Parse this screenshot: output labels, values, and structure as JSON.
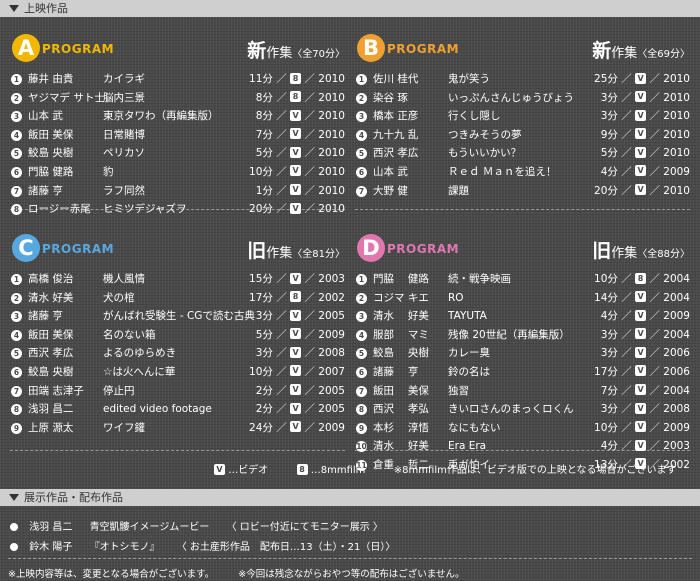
{
  "sections": {
    "screening_title": "上映作品",
    "exhibit_title": "展示作品・配布作品"
  },
  "colors": {
    "A": "#f0b800",
    "B": "#f0a030",
    "C": "#58a8e0",
    "D": "#e078b0"
  },
  "panels": [
    {
      "letter": "A",
      "program_label": "PROGRAM",
      "kind_big": "新",
      "kind_rest": "作集",
      "count": "〈全70分〉",
      "rows": [
        {
          "num": "1",
          "name": "藤井 由貴",
          "title": "カイラギ",
          "len": "11分",
          "fmt": "8",
          "year": "2010"
        },
        {
          "num": "2",
          "name": "ヤジマデ サト士",
          "title": "脳内三景",
          "len": "8分",
          "fmt": "8",
          "year": "2010"
        },
        {
          "num": "3",
          "name": "山本 武",
          "title": "東京タワわ（再編集版）",
          "len": "8分",
          "fmt": "V",
          "year": "2010"
        },
        {
          "num": "4",
          "name": "飯田 美保",
          "title": "日常賭博",
          "len": "7分",
          "fmt": "V",
          "year": "2010"
        },
        {
          "num": "5",
          "name": "鮫島 央樹",
          "title": "ペリカソ",
          "len": "5分",
          "fmt": "V",
          "year": "2010"
        },
        {
          "num": "6",
          "name": "門脇 健路",
          "title": "豹",
          "len": "10分",
          "fmt": "V",
          "year": "2010"
        },
        {
          "num": "7",
          "name": "諸藤 亨",
          "title": "ラフ同然",
          "len": "1分",
          "fmt": "V",
          "year": "2010"
        },
        {
          "num": "8",
          "name": "ロージー赤尾",
          "title": "ヒミツデジャズヲ",
          "len": "20分",
          "fmt": "V",
          "year": "2010"
        }
      ]
    },
    {
      "letter": "B",
      "program_label": "PROGRAM",
      "kind_big": "新",
      "kind_rest": "作集",
      "count": "〈全69分〉",
      "rows": [
        {
          "num": "1",
          "name": "佐川 桂代",
          "title": "鬼が笑う",
          "len": "25分",
          "fmt": "V",
          "year": "2010"
        },
        {
          "num": "2",
          "name": "染谷 琢",
          "title": "いっぷんさんじゅうびょう",
          "len": "3分",
          "fmt": "V",
          "year": "2010"
        },
        {
          "num": "3",
          "name": "橋本 正彦",
          "title": "行くし隠し",
          "len": "3分",
          "fmt": "V",
          "year": "2010"
        },
        {
          "num": "4",
          "name": "九十九 乱",
          "title": "つきみそうの夢",
          "len": "9分",
          "fmt": "V",
          "year": "2010"
        },
        {
          "num": "5",
          "name": "西沢 孝広",
          "title": "もういいかい？",
          "len": "5分",
          "fmt": "V",
          "year": "2010"
        },
        {
          "num": "6",
          "name": "山本 武",
          "title": "Ｒｅｄ Ｍａｎを追え！",
          "len": "4分",
          "fmt": "V",
          "year": "2009"
        },
        {
          "num": "7",
          "name": "大野 健",
          "title": "課題",
          "len": "20分",
          "fmt": "V",
          "year": "2010"
        }
      ]
    },
    {
      "letter": "C",
      "program_label": "PROGRAM",
      "kind_big": "旧",
      "kind_rest": "作集",
      "count": "〈全81分〉",
      "rows": [
        {
          "num": "1",
          "name": "高橋 俊治",
          "title": "機人風情",
          "len": "15分",
          "fmt": "V",
          "year": "2003"
        },
        {
          "num": "2",
          "name": "清水 好美",
          "title": "犬の棺",
          "len": "17分",
          "fmt": "8",
          "year": "2002"
        },
        {
          "num": "3",
          "name": "諸藤 亨",
          "title": "がんばれ受験生 - CGで読む古典",
          "len": "3分",
          "fmt": "V",
          "year": "2005"
        },
        {
          "num": "4",
          "name": "飯田 美保",
          "title": "名のない箱",
          "len": "5分",
          "fmt": "V",
          "year": "2009"
        },
        {
          "num": "5",
          "name": "西沢 孝広",
          "title": "よるのゆらめき",
          "len": "3分",
          "fmt": "V",
          "year": "2008"
        },
        {
          "num": "6",
          "name": "鮫島 央樹",
          "title": "☆は火へんに華",
          "len": "10分",
          "fmt": "V",
          "year": "2007"
        },
        {
          "num": "7",
          "name": "田端 志津子",
          "title": "停止円",
          "len": "2分",
          "fmt": "V",
          "year": "2005"
        },
        {
          "num": "8",
          "name": "浅羽 昌二",
          "title": "edited video footage",
          "len": "2分",
          "fmt": "V",
          "year": "2005"
        },
        {
          "num": "9",
          "name": "上原 源太",
          "title": "ワイフ鑵",
          "len": "24分",
          "fmt": "V",
          "year": "2009"
        }
      ]
    },
    {
      "letter": "D",
      "program_label": "PROGRAM",
      "kind_big": "旧",
      "kind_rest": "作集",
      "count": "〈全88分〉",
      "rows": [
        {
          "num": "1",
          "name": "門脇 　健路",
          "title": "続・戦争映画",
          "len": "10分",
          "fmt": "8",
          "year": "2004"
        },
        {
          "num": "2",
          "name": "コジマ キエ",
          "title": "RO",
          "len": "14分",
          "fmt": "V",
          "year": "2004"
        },
        {
          "num": "3",
          "name": "清水 　好美",
          "title": "TAYUTA",
          "len": "4分",
          "fmt": "V",
          "year": "2009"
        },
        {
          "num": "4",
          "name": "服部 　マミ",
          "title": "残像 20世紀（再編集版）",
          "len": "3分",
          "fmt": "V",
          "year": "2004"
        },
        {
          "num": "5",
          "name": "鮫島 　央樹",
          "title": "カレー臭",
          "len": "3分",
          "fmt": "V",
          "year": "2006"
        },
        {
          "num": "6",
          "name": "諸藤 　亨",
          "title": "鈴の名は",
          "len": "17分",
          "fmt": "V",
          "year": "2006"
        },
        {
          "num": "7",
          "name": "飯田 　美保",
          "title": "独習",
          "len": "7分",
          "fmt": "V",
          "year": "2004"
        },
        {
          "num": "8",
          "name": "西沢 　孝弘",
          "title": "きいロさんのまっくロくん",
          "len": "3分",
          "fmt": "V",
          "year": "2008"
        },
        {
          "num": "9",
          "name": "本杉 　淳悟",
          "title": "なにもない",
          "len": "10分",
          "fmt": "V",
          "year": "2009"
        },
        {
          "num": "10",
          "name": "清水 　好美",
          "title": "Era Era",
          "len": "4分",
          "fmt": "V",
          "year": "2003"
        },
        {
          "num": "11",
          "name": "倉重 　哲二",
          "title": "兎ガ怕イ",
          "len": "13分",
          "fmt": "V",
          "year": "2002"
        }
      ]
    }
  ],
  "legend": {
    "video_mark": "V",
    "video_text": "…ビデオ",
    "film_mark": "8",
    "film_text": "…8mmfilm",
    "note": "※8mmfilm作品は、ビデオ版での上映となる場合がございます"
  },
  "exhibits": [
    {
      "name": "浅羽 昌二",
      "title": "青空凱髏イメージムービー",
      "note": "〈 ロビー付近にてモニター展示 〉"
    },
    {
      "name": "鈴木 陽子",
      "title": "『オトシモノ』",
      "note": "〈 お土産形作品　配布日…13（土）・21（日）〉"
    }
  ],
  "footer": {
    "note1": "※上映内容等は、変更となる場合がございます。",
    "note2": "※今回は残念ながらおやつ等の配布はございません。"
  }
}
